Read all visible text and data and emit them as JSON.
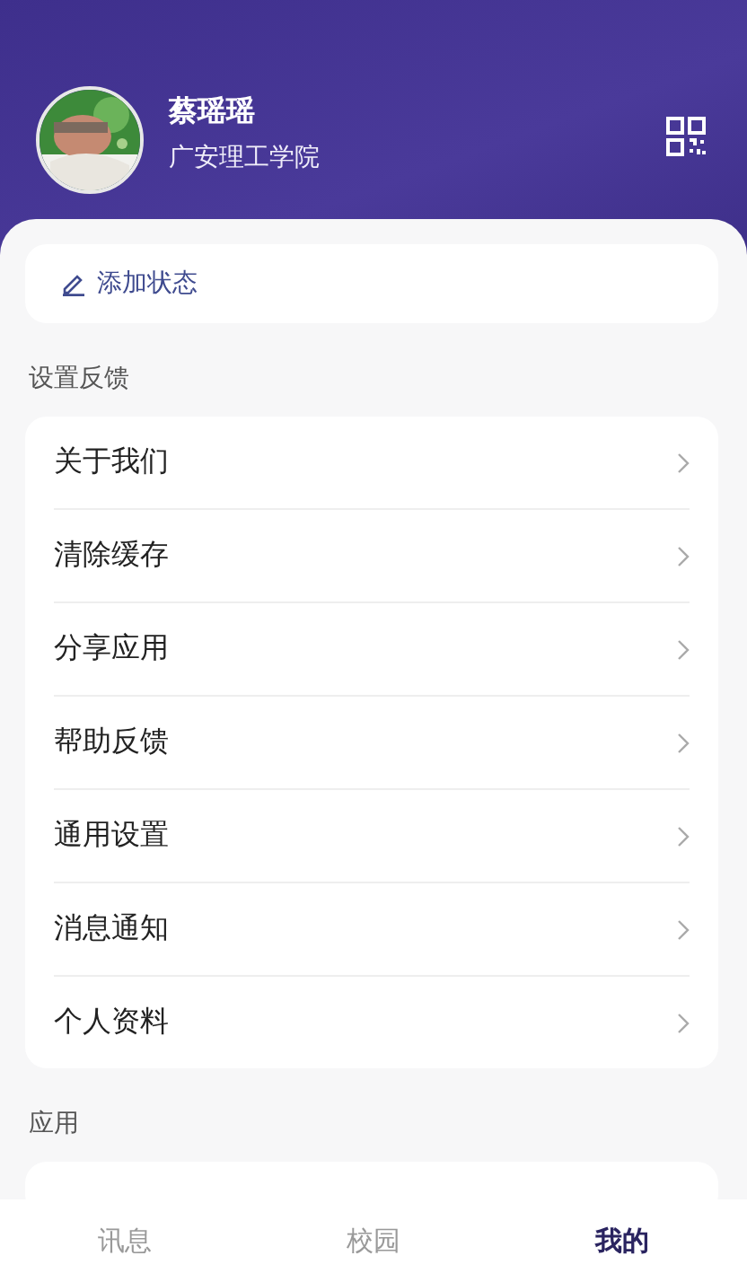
{
  "profile": {
    "name": "蔡瑶瑶",
    "school": "广安理工学院"
  },
  "status_button": {
    "label": "添加状态"
  },
  "sections": [
    {
      "title": "设置反馈",
      "items": [
        {
          "label": "关于我们"
        },
        {
          "label": "清除缓存"
        },
        {
          "label": "分享应用"
        },
        {
          "label": "帮助反馈"
        },
        {
          "label": "通用设置"
        },
        {
          "label": "消息通知"
        },
        {
          "label": "个人资料"
        }
      ]
    },
    {
      "title": "应用"
    }
  ],
  "tabs": [
    {
      "label": "讯息",
      "selected": false
    },
    {
      "label": "校园",
      "selected": false
    },
    {
      "label": "我的",
      "selected": true
    }
  ]
}
